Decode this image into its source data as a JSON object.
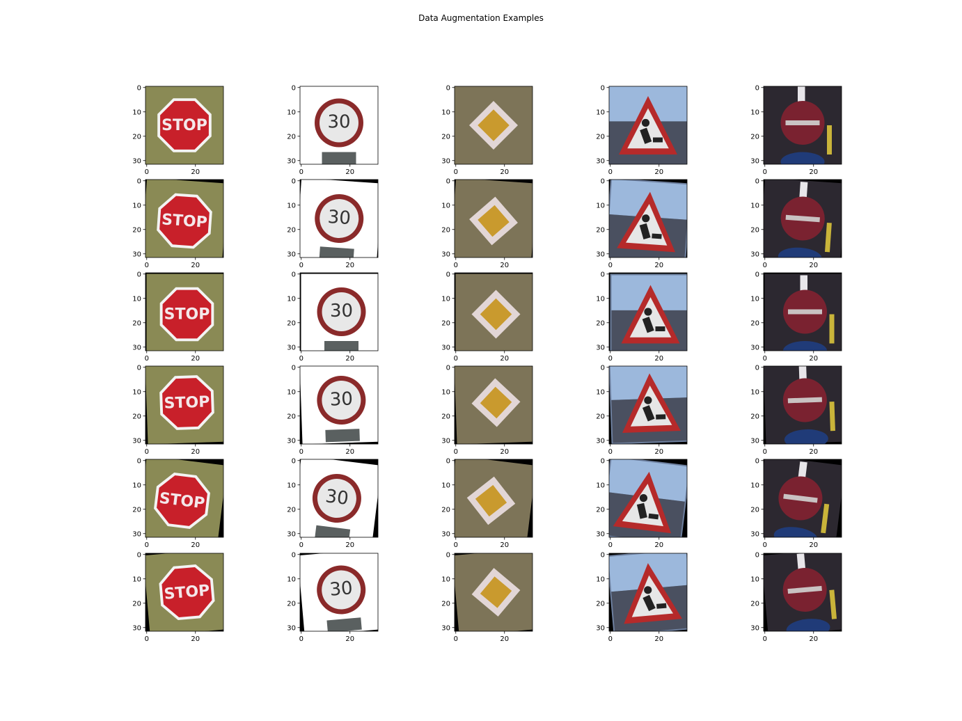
{
  "title": "Data Augmentation Examples",
  "chart_data": {
    "type": "image-grid",
    "rows": 6,
    "cols": 5,
    "xticks": [
      "0",
      "20"
    ],
    "yticks": [
      "0",
      "10",
      "20",
      "30"
    ],
    "columns": [
      {
        "sign": "stop",
        "bg": "#8a8a55",
        "fg": "#c8202a",
        "accent": "#f3f3f3",
        "text": "STOP"
      },
      {
        "sign": "speed-limit",
        "bg": "#ffffff",
        "fg": "#8a2a2a",
        "accent": "#e8e8e8",
        "text": "30"
      },
      {
        "sign": "priority-road",
        "bg": "#7d7458",
        "fg": "#e2d6d6",
        "accent": "#c99a2e",
        "text": ""
      },
      {
        "sign": "road-work",
        "bg": "#6d7f9e",
        "fg": "#b52a2a",
        "accent": "#e6e6e6",
        "text": ""
      },
      {
        "sign": "no-entry",
        "bg": "#2c2830",
        "fg": "#7a2230",
        "accent": "#c9c2c2",
        "text": ""
      }
    ],
    "augmentations": [
      {
        "row": 0,
        "rotate": 0,
        "shift": [
          0,
          0
        ],
        "border": false
      },
      {
        "row": 1,
        "rotate": 4,
        "shift": [
          0,
          1
        ],
        "border": true
      },
      {
        "row": 2,
        "rotate": 0,
        "shift": [
          1,
          1
        ],
        "border": true
      },
      {
        "row": 3,
        "rotate": -2,
        "shift": [
          1,
          -1
        ],
        "border": true
      },
      {
        "row": 4,
        "rotate": 7,
        "shift": [
          -1,
          1
        ],
        "border": true
      },
      {
        "row": 5,
        "rotate": -5,
        "shift": [
          1,
          0
        ],
        "border": true
      }
    ]
  }
}
